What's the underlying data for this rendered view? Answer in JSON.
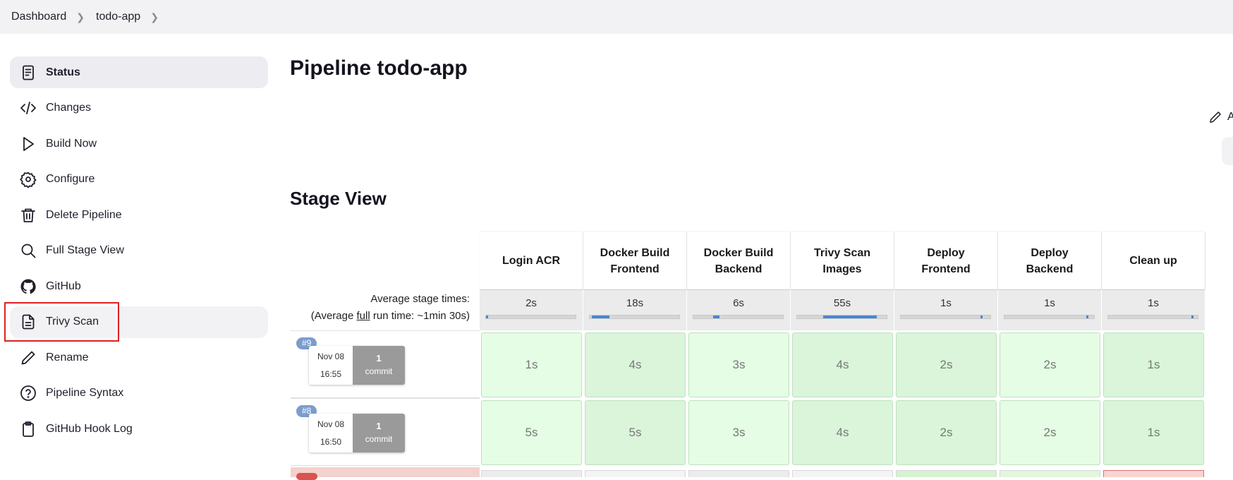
{
  "breadcrumb": {
    "items": [
      "Dashboard",
      "todo-app"
    ]
  },
  "sidebar": {
    "items": [
      {
        "label": "Status",
        "icon": "document-icon",
        "active": true
      },
      {
        "label": "Changes",
        "icon": "code-icon"
      },
      {
        "label": "Build Now",
        "icon": "play-icon"
      },
      {
        "label": "Configure",
        "icon": "gear-icon"
      },
      {
        "label": "Delete Pipeline",
        "icon": "trash-icon"
      },
      {
        "label": "Full Stage View",
        "icon": "search-icon"
      },
      {
        "label": "GitHub",
        "icon": "github-icon"
      },
      {
        "label": "Trivy Scan",
        "icon": "file-text-icon",
        "highlighted": true
      },
      {
        "label": "Rename",
        "icon": "pencil-icon"
      },
      {
        "label": "Pipeline Syntax",
        "icon": "help-circle-icon"
      },
      {
        "label": "GitHub Hook Log",
        "icon": "clipboard-icon"
      }
    ]
  },
  "main": {
    "title": "Pipeline todo-app",
    "stage_view_title": "Stage View",
    "edit_text": "A"
  },
  "stage_view": {
    "avg_label": "Average stage times:",
    "avg_run_prefix": "(Average ",
    "avg_run_link": "full",
    "avg_run_suffix": " run time: ~1min 30s)",
    "stages": [
      {
        "name_line1": "Login ACR",
        "name_line2": "",
        "avg": "2s",
        "bar_fraction": 0.02
      },
      {
        "name_line1": "Docker Build",
        "name_line2": "Frontend",
        "avg": "18s",
        "bar_fraction": 0.2
      },
      {
        "name_line1": "Docker Build",
        "name_line2": "Backend",
        "avg": "6s",
        "bar_fraction": 0.07
      },
      {
        "name_line1": "Trivy Scan",
        "name_line2": "Images",
        "avg": "55s",
        "bar_fraction": 0.6
      },
      {
        "name_line1": "Deploy",
        "name_line2": "Frontend",
        "avg": "1s",
        "bar_fraction": 0.02
      },
      {
        "name_line1": "Deploy",
        "name_line2": "Backend",
        "avg": "1s",
        "bar_fraction": 0.02
      },
      {
        "name_line1": "Clean up",
        "name_line2": "",
        "avg": "1s",
        "bar_fraction": 0.02
      }
    ],
    "builds": [
      {
        "number": "#9",
        "date": "Nov 08",
        "time": "16:55",
        "commits_count": "1",
        "commits_label": "commit",
        "durations": [
          "1s",
          "4s",
          "3s",
          "4s",
          "2s",
          "2s",
          "1s"
        ]
      },
      {
        "number": "#8",
        "date": "Nov 08",
        "time": "16:50",
        "commits_count": "1",
        "commits_label": "commit",
        "durations": [
          "5s",
          "5s",
          "3s",
          "4s",
          "2s",
          "2s",
          "1s"
        ]
      }
    ]
  }
}
